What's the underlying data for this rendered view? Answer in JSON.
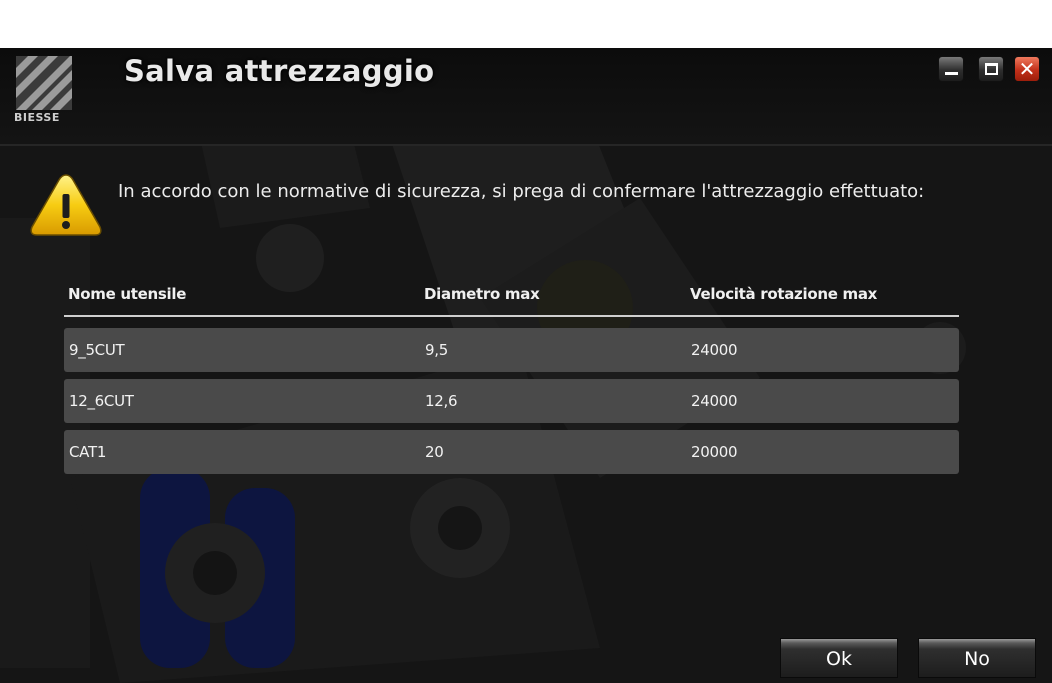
{
  "window": {
    "title": "Salva attrezzaggio",
    "logo_text": "BIESSE",
    "controls": {
      "minimize": "minimize-icon",
      "maximize": "maximize-icon",
      "close": "close-icon",
      "close_glyph": "✕"
    }
  },
  "message": "In accordo con le normative di sicurezza, si prega di confermare l'attrezzaggio effettuato:",
  "table": {
    "columns": [
      "Nome utensile",
      "Diametro max",
      "Velocità rotazione max"
    ],
    "rows": [
      [
        "9_5CUT",
        "9,5",
        "24000"
      ],
      [
        "12_6CUT",
        "12,6",
        "24000"
      ],
      [
        "CAT1",
        "20",
        "20000"
      ]
    ]
  },
  "buttons": {
    "ok": "Ok",
    "no": "No"
  },
  "colors": {
    "accent_close": "#c2301a",
    "warning": "#f5c400",
    "row_bg": "#4a4a4a"
  }
}
